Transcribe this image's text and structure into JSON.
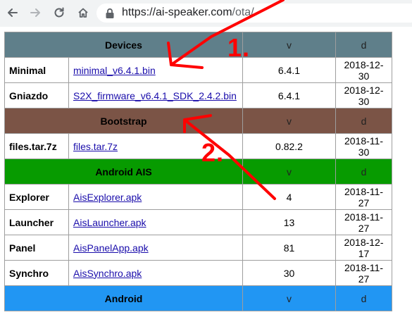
{
  "browser": {
    "url_host": "https://ai-speaker.com",
    "url_path": "/ota/"
  },
  "annotations": {
    "one": "1.",
    "two": "2.",
    "color": "#ff0000"
  },
  "sections": [
    {
      "title": "Devices",
      "v": "v",
      "d": "d",
      "color": "#5f7f8a",
      "rows": [
        {
          "name": "Minimal",
          "file": "minimal_v6.4.1.bin",
          "version": "6.4.1",
          "date": "2018-12-30"
        },
        {
          "name": "Gniazdo",
          "file": "S2X_firmware_v6.4.1_SDK_2.4.2.bin",
          "version": "6.4.1",
          "date": "2018-12-30"
        }
      ]
    },
    {
      "title": "Bootstrap",
      "v": "v",
      "d": "d",
      "color": "#7b5446",
      "rows": [
        {
          "name": "files.tar.7z",
          "file": "files.tar.7z",
          "version": "0.82.2",
          "date": "2018-11-30"
        }
      ]
    },
    {
      "title": "Android AIS",
      "v": "v",
      "d": "d",
      "color": "#079b00",
      "rows": [
        {
          "name": "Explorer",
          "file": "AisExplorer.apk",
          "version": "4",
          "date": "2018-11-27"
        },
        {
          "name": "Launcher",
          "file": "AisLauncher.apk",
          "version": "13",
          "date": "2018-11-27"
        },
        {
          "name": "Panel",
          "file": "AisPanelApp.apk",
          "version": "81",
          "date": "2018-12-17"
        },
        {
          "name": "Synchro",
          "file": "AisSynchro.apk",
          "version": "30",
          "date": "2018-11-27"
        }
      ]
    },
    {
      "title": "Android",
      "v": "v",
      "d": "d",
      "color": "#2196f3",
      "rows": []
    }
  ]
}
